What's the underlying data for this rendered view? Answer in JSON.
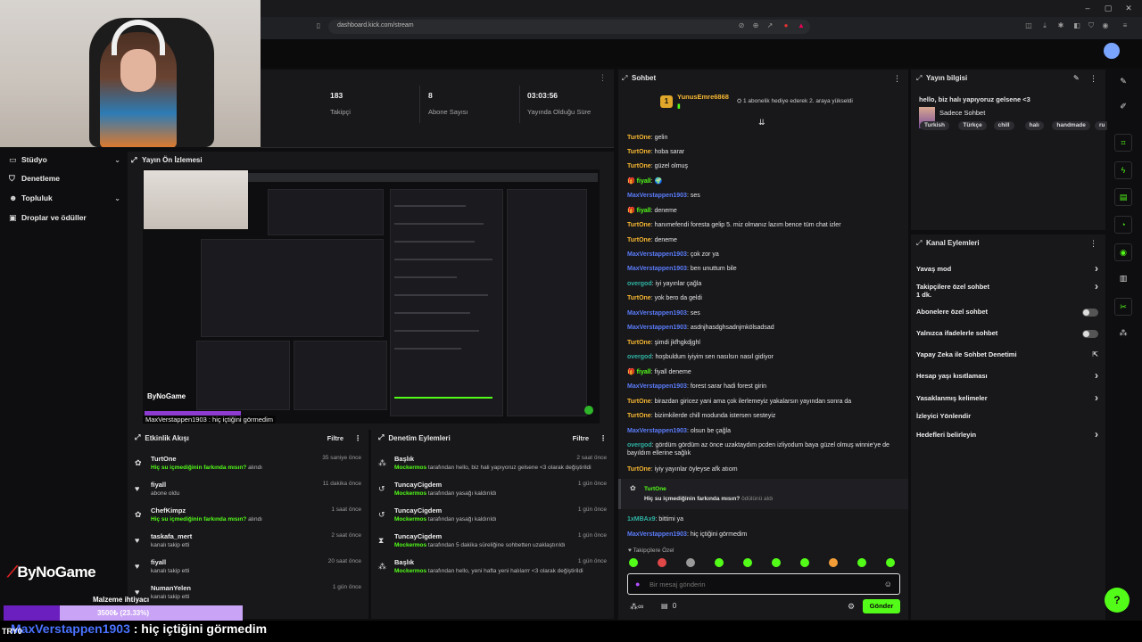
{
  "browser": {
    "url": "dashboard.kick.com/stream"
  },
  "sidebar": {
    "items": [
      {
        "label": "Stüdyo",
        "icon": "monitor-icon",
        "chevron": true
      },
      {
        "label": "Denetleme",
        "icon": "shield-icon",
        "chevron": false
      },
      {
        "label": "Topluluk",
        "icon": "users-icon",
        "chevron": true
      },
      {
        "label": "Droplar ve ödüller",
        "icon": "gift-icon",
        "chevron": false
      }
    ]
  },
  "stats": [
    {
      "value": "183",
      "label": "Takipçi"
    },
    {
      "value": "8",
      "label": "Abone Sayısı"
    },
    {
      "value": "03:03:56",
      "label": "Yayında Olduğu Süre"
    }
  ],
  "preview": {
    "title": "Yayın Ön İzlemesi",
    "logo": "ByNoGame",
    "caption": "MaxVerstappen1903 : hiç içtiğini görmedim"
  },
  "activity": {
    "title": "Etkinlik Akışı",
    "filter": "Filtre",
    "rows": [
      {
        "icon": "gift-icon",
        "user": "TurtOne",
        "time": "35 saniye önce",
        "highlight": "Hiç su içmediğinin farkında mısın?",
        "rest": " alındı"
      },
      {
        "icon": "heart-icon",
        "user": "fiyall",
        "time": "11 dakika önce",
        "highlight": "",
        "rest": "abone oldu"
      },
      {
        "icon": "gift-icon",
        "user": "ChefKimpz",
        "time": "1 saat önce",
        "highlight": "Hiç su içmediğinin farkında mısın?",
        "rest": " alındı"
      },
      {
        "icon": "heart-icon",
        "user": "taskafa_mert",
        "time": "2 saat önce",
        "highlight": "",
        "rest": "kanalı takip etti"
      },
      {
        "icon": "heart-icon",
        "user": "fiyall",
        "time": "20 saat önce",
        "highlight": "",
        "rest": "kanalı takip etti"
      },
      {
        "icon": "heart-icon",
        "user": "NumanYelen",
        "time": "1 gün önce",
        "highlight": "",
        "rest": "kanalı takip etti"
      }
    ]
  },
  "moderation": {
    "title": "Denetim Eylemleri",
    "filter": "Filtre",
    "rows": [
      {
        "icon": "users-icon",
        "user": "Başlık",
        "time": "2 saat önce",
        "actor": "Mockermos",
        "rest": " tarafından hello, biz hali yapıyoruz gelsene <3 olarak değiştirildi"
      },
      {
        "icon": "undo-icon",
        "user": "TuncayCigdem",
        "time": "1 gün önce",
        "actor": "Mockermos",
        "rest": " tarafından yasağı kaldırıldı"
      },
      {
        "icon": "undo-icon",
        "user": "TuncayCigdem",
        "time": "1 gün önce",
        "actor": "Mockermos",
        "rest": " tarafından yasağı kaldırıldı"
      },
      {
        "icon": "hourglass-icon",
        "user": "TuncayCigdem",
        "time": "1 gün önce",
        "actor": "Mockermos",
        "rest": " tarafından 5 dakika süreliğine sohbetten uzaklaştırıldı"
      },
      {
        "icon": "users-icon",
        "user": "Başlık",
        "time": "1 gün önce",
        "actor": "Mockermos",
        "rest": " tarafından hello, yeni hafta yeni halılarrr <3 olarak değiştirildi"
      }
    ]
  },
  "chat": {
    "title": "Sohbet",
    "pinned_user": "YunusEmre6868",
    "pinned_text": "1 abonelik hediye ederek 2. araya yükseldi",
    "messages": [
      {
        "user": "TurtOne",
        "color": "#f7b731",
        "text": "gelin"
      },
      {
        "user": "TurtOne",
        "color": "#f7b731",
        "text": "hoba sarar"
      },
      {
        "user": "TurtOne",
        "color": "#f7b731",
        "text": "güzel olmuş"
      },
      {
        "user": "fiyall",
        "color": "#53fc18",
        "text": "🌍"
      },
      {
        "user": "MaxVerstappen1903",
        "color": "#5b7cfa",
        "text": "ses"
      },
      {
        "user": "fiyall",
        "color": "#53fc18",
        "text": "deneme"
      },
      {
        "user": "TurtOne",
        "color": "#f7b731",
        "text": "hanımefendi foresta gelip 5. miz olmanız lazım bence tüm chat izler"
      },
      {
        "user": "TurtOne",
        "color": "#f7b731",
        "text": "deneme"
      },
      {
        "user": "MaxVerstappen1903",
        "color": "#5b7cfa",
        "text": "çok zor ya"
      },
      {
        "user": "MaxVerstappen1903",
        "color": "#5b7cfa",
        "text": "ben unuttum bile"
      },
      {
        "user": "overgod",
        "color": "#2fb3a3",
        "text": "iyi yayınlar çağla"
      },
      {
        "user": "TurtOne",
        "color": "#f7b731",
        "text": "yok bero da geldi"
      },
      {
        "user": "MaxVerstappen1903",
        "color": "#5b7cfa",
        "text": "ses"
      },
      {
        "user": "MaxVerstappen1903",
        "color": "#5b7cfa",
        "text": "asdnjhasdghsadnjmkölsadsad"
      },
      {
        "user": "TurtOne",
        "color": "#f7b731",
        "text": "şimdi jkfhgkdjghl"
      },
      {
        "user": "overgod",
        "color": "#2fb3a3",
        "text": "hoşbuldum iyiyim sen nasılsın nasıl gidiyor"
      },
      {
        "user": "fiyall",
        "color": "#53fc18",
        "text": "fiyall deneme"
      },
      {
        "user": "MaxVerstappen1903",
        "color": "#5b7cfa",
        "text": "forest sarar hadi forest girin"
      },
      {
        "user": "TurtOne",
        "color": "#f7b731",
        "text": "birazdan giricez yani ama çok ilerlemeyiz yakalarsın yayından sonra da"
      },
      {
        "user": "TurtOne",
        "color": "#f7b731",
        "text": "bizimkilerde chill modunda istersen sesteyiz"
      },
      {
        "user": "MaxVerstappen1903",
        "color": "#5b7cfa",
        "text": "olsun be çağla"
      },
      {
        "user": "overgod",
        "color": "#2fb3a3",
        "text": "gördüm gördüm az önce uzaktaydım pcden izliyodum baya güzel olmuş winnie'ye de bayıldım ellerine sağlık"
      },
      {
        "user": "TurtOne",
        "color": "#f7b731",
        "text": "iyiy yayınlar öyleyse afk atıom"
      }
    ],
    "redeem_user": "TurtOne",
    "redeem_title": "Hiç su içmediğinin farkında mısın?",
    "redeem_suffix": " ödülünü aldı",
    "after_messages": [
      {
        "user": "1xMBAx9",
        "color": "#2fb3a3",
        "text": "bittimi ya"
      },
      {
        "user": "MaxVerstappen1903",
        "color": "#5b7cfa",
        "text": "hiç içtiğini görmedim"
      }
    ],
    "followers_only": "Takipçilere Özel",
    "placeholder": "Bir mesaj gönderin",
    "count": "0",
    "send_label": "Gönder"
  },
  "stream_info": {
    "title": "Yayın bilgisi",
    "stream_title": "hello, biz halı yapıyoruz gelsene <3",
    "category": "Sadece Sohbet",
    "tags": [
      "Turkish",
      "Türkçe",
      "chill",
      "halı",
      "handmade",
      "ru"
    ]
  },
  "channel_actions": {
    "title": "Kanal Eylemleri",
    "rows": [
      {
        "label": "Yavaş mod",
        "sub": "",
        "control": "chevron"
      },
      {
        "label": "Takipçilere özel sohbet",
        "sub": "1 dk.",
        "control": "chevron"
      },
      {
        "label": "Abonelere özel sohbet",
        "sub": "",
        "control": "toggle"
      },
      {
        "label": "Yalnızca ifadelerle sohbet",
        "sub": "",
        "control": "toggle"
      },
      {
        "label": "Yapay Zeka ile Sohbet Denetimi",
        "sub": "",
        "control": "external"
      },
      {
        "label": "Hesap yaşı kısıtlaması",
        "sub": "",
        "control": "chevron"
      },
      {
        "label": "Yasaklanmış kelimeler",
        "sub": "",
        "control": "chevron"
      },
      {
        "label": "İzleyici Yönlendir",
        "sub": "",
        "control": "none"
      },
      {
        "label": "Hedefleri belirleyin",
        "sub": "",
        "control": "chevron"
      }
    ]
  },
  "overlay": {
    "logo": "ByNoGame",
    "goal_label": "Malzeme ihtiyacı",
    "goal_text": "3500₺ (23.33%)",
    "goal_progress": 0.2333,
    "ticker_left": "TRY0",
    "ticker_name": "MaxVerstappen1903",
    "ticker_text": " : hiç içtiğini görmedim"
  },
  "colors": {
    "accent": "#53fc18",
    "panel": "#18181b",
    "background": "#0e0e10",
    "goal_fill": "#6b1fbf"
  }
}
